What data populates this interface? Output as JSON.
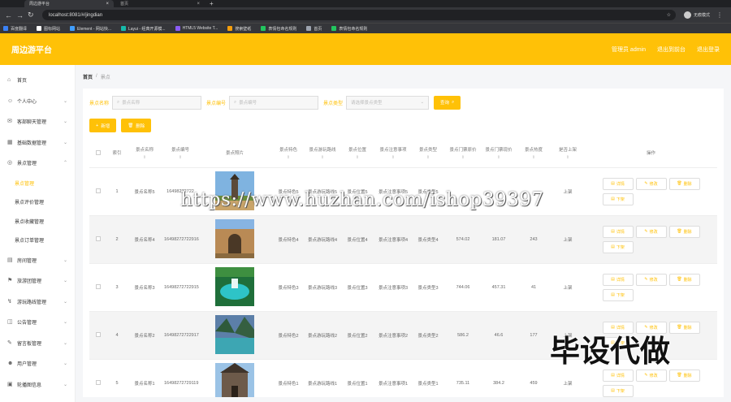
{
  "browser": {
    "tabs": [
      {
        "title": "周边游平台"
      },
      {
        "title": "首页"
      }
    ],
    "new_tab": "+",
    "url": "localhost:8081/#/jingdian",
    "profile": "无痕模式",
    "bookmarks": [
      {
        "label": "百度翻译",
        "color": "#3b82f6"
      },
      {
        "label": "图标网站",
        "color": "#ffffff"
      },
      {
        "label": "Element - 网站快...",
        "color": "#409eff"
      },
      {
        "label": "Layui - 经典开源模...",
        "color": "#16baaa"
      },
      {
        "label": "HTML5 Website T...",
        "color": "#8b5cf6"
      },
      {
        "label": "搜索壁纸",
        "color": "#f59e0b"
      },
      {
        "label": "表情包命名规则",
        "color": "#22c55e"
      },
      {
        "label": "首页",
        "color": "#9ca3af"
      },
      {
        "label": "表情包命名规则",
        "color": "#22c55e"
      }
    ]
  },
  "header": {
    "title": "周边游平台",
    "user": "管理员 admin",
    "back_front": "退出到前台",
    "logout": "退出登录",
    "accent": "#ffc107"
  },
  "sidebar": {
    "items": [
      {
        "label": "首页",
        "icon": "home-icon",
        "has_children": false
      },
      {
        "label": "个人中心",
        "icon": "user-icon",
        "has_children": true
      },
      {
        "label": "客部聊天管理",
        "icon": "chat-icon",
        "has_children": true
      },
      {
        "label": "基础数据管理",
        "icon": "grid-icon",
        "has_children": true
      },
      {
        "label": "景点管理",
        "icon": "location-icon",
        "has_children": true,
        "expanded": true,
        "children": [
          {
            "label": "景点管理",
            "active": true
          },
          {
            "label": "景点评价管理",
            "active": false
          },
          {
            "label": "景点收藏管理",
            "active": false
          },
          {
            "label": "景点订单管理",
            "active": false
          }
        ]
      },
      {
        "label": "房间管理",
        "icon": "room-icon",
        "has_children": true
      },
      {
        "label": "旅游团管理",
        "icon": "group-icon",
        "has_children": true
      },
      {
        "label": "游玩路线管理",
        "icon": "route-icon",
        "has_children": true
      },
      {
        "label": "公告管理",
        "icon": "notice-icon",
        "has_children": true
      },
      {
        "label": "留言板管理",
        "icon": "message-icon",
        "has_children": true
      },
      {
        "label": "用户管理",
        "icon": "users-icon",
        "has_children": true
      },
      {
        "label": "轮播图信息",
        "icon": "image-icon",
        "has_children": true
      }
    ]
  },
  "breadcrumb": {
    "home": "首页",
    "current": "景点"
  },
  "search": {
    "name_label": "景点名称",
    "name_placeholder": "景点名称",
    "code_label": "景点编号",
    "code_placeholder": "景点编号",
    "type_label": "景点类型",
    "type_placeholder": "请选择景点类型",
    "query_button": "查询"
  },
  "actions": {
    "add": "新增",
    "delete": "删除"
  },
  "table": {
    "headers": [
      "索引",
      "景点名称",
      "景点编号",
      "景点照片",
      "景点特色",
      "景点游玩路线",
      "景点位置",
      "景点注意事项",
      "景点类型",
      "景点门票原价",
      "景点门票现价",
      "景点热度",
      "是否上架",
      "操作"
    ],
    "op_labels": {
      "detail": "详情",
      "edit": "修改",
      "delete": "删除",
      "offline": "下架"
    },
    "rows": [
      {
        "index": "1",
        "name": "景点名称5",
        "code": "16498272722",
        "photo": "tower",
        "feature": "景点特色5",
        "route": "景点游玩路线5",
        "location": "景点位置5",
        "notice": "景点注意事项5",
        "type": "景点类型5",
        "orig_price": "",
        "cur_price": "",
        "heat": "",
        "status": "上架"
      },
      {
        "index": "2",
        "name": "景点名称4",
        "code": "16498272722916",
        "photo": "arch",
        "feature": "景点特色4",
        "route": "景点游玩路线4",
        "location": "景点位置4",
        "notice": "景点注意事项4",
        "type": "景点类型4",
        "orig_price": "574.02",
        "cur_price": "181.07",
        "heat": "243",
        "status": "上架"
      },
      {
        "index": "3",
        "name": "景点名称3",
        "code": "16498272722915",
        "photo": "lake",
        "feature": "景点特色3",
        "route": "景点游玩路线3",
        "location": "景点位置3",
        "notice": "景点注意事项3",
        "type": "景点类型3",
        "orig_price": "744.06",
        "cur_price": "457.31",
        "heat": "41",
        "status": "上架"
      },
      {
        "index": "4",
        "name": "景点名称2",
        "code": "16498272722917",
        "photo": "valley",
        "feature": "景点特色2",
        "route": "景点游玩路线2",
        "location": "景点位置2",
        "notice": "景点注意事项2",
        "type": "景点类型2",
        "orig_price": "586.2",
        "cur_price": "46.6",
        "heat": "177",
        "status": "上架"
      },
      {
        "index": "5",
        "name": "景点名称1",
        "code": "16498272729119",
        "photo": "building",
        "feature": "景点特色1",
        "route": "景点游玩路线1",
        "location": "景点位置1",
        "notice": "景点注意事项1",
        "type": "景点类型1",
        "orig_price": "735.11",
        "cur_price": "384.2",
        "heat": "459",
        "status": "上架"
      }
    ]
  },
  "watermark_text": "https://www.huzhan.com/ishop39397",
  "watermark_cn": "毕设代做"
}
